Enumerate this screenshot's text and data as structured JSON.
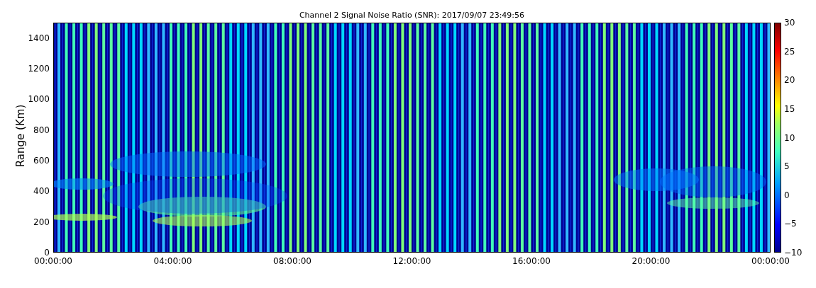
{
  "title": "Channel 2 Signal Noise Ratio (SNR): 2017/09/07 23:49:56",
  "y_axis": {
    "label": "Range (Km)",
    "ticks": [
      "1400",
      "1200",
      "1000",
      "800",
      "600",
      "400",
      "200",
      "0"
    ]
  },
  "x_axis": {
    "ticks": [
      "00:00:00",
      "04:00:00",
      "08:00:00",
      "12:00:00",
      "16:00:00",
      "20:00:00",
      "00:00:00"
    ]
  },
  "colorbar": {
    "ticks": [
      "30",
      "25",
      "20",
      "15",
      "10",
      "5",
      "0",
      "−5",
      "−10"
    ]
  }
}
